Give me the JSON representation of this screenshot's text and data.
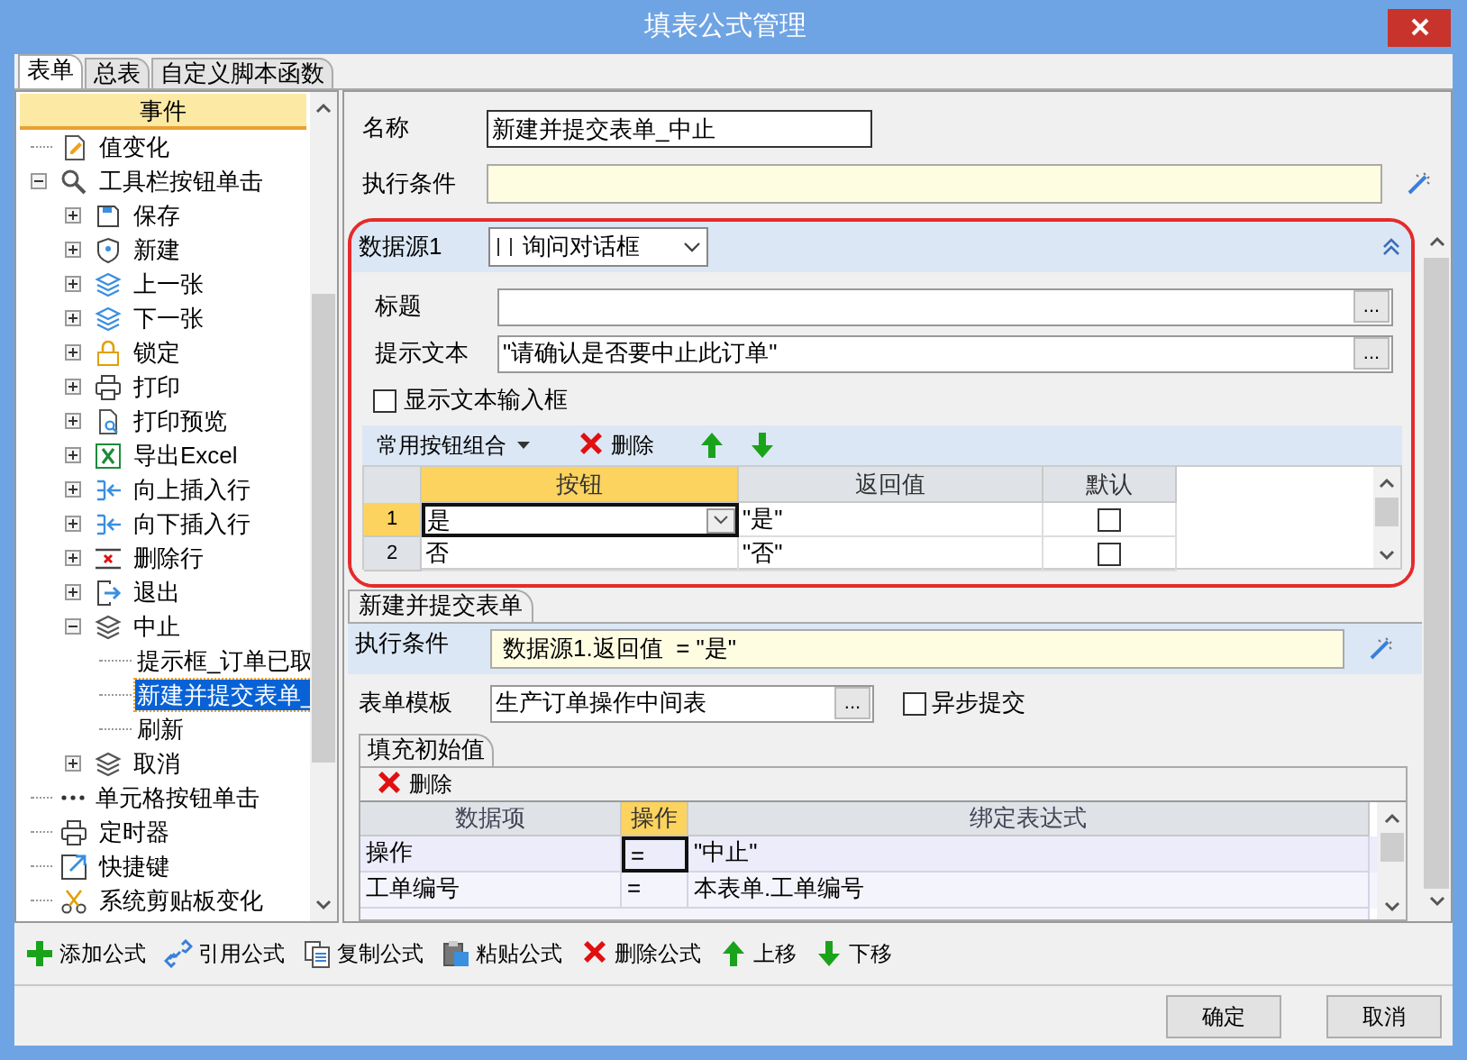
{
  "window": {
    "title": "填表公式管理"
  },
  "tabs": [
    {
      "label": "表单",
      "selected": true
    },
    {
      "label": "总表",
      "selected": false
    },
    {
      "label": "自定义脚本函数",
      "selected": false
    }
  ],
  "tree": {
    "header": "事件",
    "items": [
      {
        "label": "值变化",
        "selected": false
      },
      {
        "label": "工具栏按钮单击",
        "selected": false,
        "expanded": true,
        "children": [
          {
            "label": "保存",
            "selected": false,
            "expanded": false
          },
          {
            "label": "新建",
            "selected": false,
            "expanded": false
          },
          {
            "label": "上一张",
            "selected": false,
            "expanded": false
          },
          {
            "label": "下一张",
            "selected": false,
            "expanded": false
          },
          {
            "label": "锁定",
            "selected": false,
            "expanded": false
          },
          {
            "label": "打印",
            "selected": false,
            "expanded": false
          },
          {
            "label": "打印预览",
            "selected": false,
            "expanded": false
          },
          {
            "label": "导出Excel",
            "selected": false,
            "expanded": false
          },
          {
            "label": "向上插入行",
            "selected": false,
            "expanded": false
          },
          {
            "label": "向下插入行",
            "selected": false,
            "expanded": false
          },
          {
            "label": "删除行",
            "selected": false,
            "expanded": false
          },
          {
            "label": "退出",
            "selected": false,
            "expanded": false
          },
          {
            "label": "中止",
            "selected": false,
            "expanded": true,
            "children": [
              {
                "label": "提示框_订单已取",
                "selected": false
              },
              {
                "label": "新建并提交表单_",
                "selected": true
              },
              {
                "label": "刷新",
                "selected": false
              }
            ]
          },
          {
            "label": "取消",
            "selected": false,
            "expanded": false
          }
        ]
      },
      {
        "label": "单元格按钮单击",
        "selected": false
      },
      {
        "label": "定时器",
        "selected": false
      },
      {
        "label": "快捷键",
        "selected": false
      },
      {
        "label": "系统剪贴板变化",
        "selected": false
      }
    ]
  },
  "form": {
    "name_label": "名称",
    "name_value": "新建并提交表单_中止",
    "condition_label": "执行条件"
  },
  "datasource": {
    "label": "数据源1",
    "type_value": "询问对话框",
    "expanded": true,
    "title_label": "标题",
    "title_button": "...",
    "prompt_label": "提示文本",
    "prompt_button": "...",
    "prompt_value": "\"请确认是否要中止此订单\"",
    "show_input_label": "显示文本输入框",
    "show_input_checked": false,
    "toolbar": [
      {
        "kind": "menu",
        "label": "常用按钮组合"
      },
      {
        "kind": "delete",
        "label": "删除"
      },
      {
        "kind": "up"
      },
      {
        "kind": "down"
      }
    ],
    "grid": {
      "columns": [
        {
          "label": "按钮",
          "selected": true
        },
        {
          "label": "返回值",
          "selected": false
        },
        {
          "label": "默认",
          "selected": false
        }
      ],
      "rows": [
        {
          "number": "1",
          "selected": true,
          "button": "是",
          "return_value": "\"是\"",
          "default": false
        },
        {
          "number": "2",
          "selected": false,
          "button": "否",
          "return_value": "\"否\"",
          "default": false
        }
      ]
    }
  },
  "action": {
    "tab": "新建并提交表单",
    "condition_label": "执行条件",
    "condition_value": "数据源1.返回值  = \"是\"",
    "template_label": "表单模板",
    "template_value": "生产订单操作中间表",
    "template_button": "...",
    "async_label": "异步提交",
    "async_checked": false,
    "fill_tab": "填充初始值",
    "delete_label": "删除",
    "grid": {
      "columns": [
        {
          "label": "数据项",
          "selected": false
        },
        {
          "label": "操作",
          "selected": true
        },
        {
          "label": "绑定表达式",
          "selected": false
        }
      ],
      "rows": [
        {
          "cells": [
            "操作",
            "=",
            "\"中止\""
          ],
          "selected": true
        },
        {
          "cells": [
            "工单编号",
            "=",
            "本表单.工单编号"
          ],
          "selected": false
        }
      ]
    }
  },
  "toolbar": [
    {
      "kind": "add",
      "label": "添加公式"
    },
    {
      "kind": "link",
      "label": "引用公式"
    },
    {
      "kind": "copy",
      "label": "复制公式"
    },
    {
      "kind": "paste",
      "label": "粘贴公式"
    },
    {
      "kind": "delete",
      "label": "删除公式"
    },
    {
      "kind": "up",
      "label": "上移"
    },
    {
      "kind": "down",
      "label": "下移"
    }
  ],
  "buttons": [
    {
      "label": "确定"
    },
    {
      "label": "取消"
    }
  ]
}
